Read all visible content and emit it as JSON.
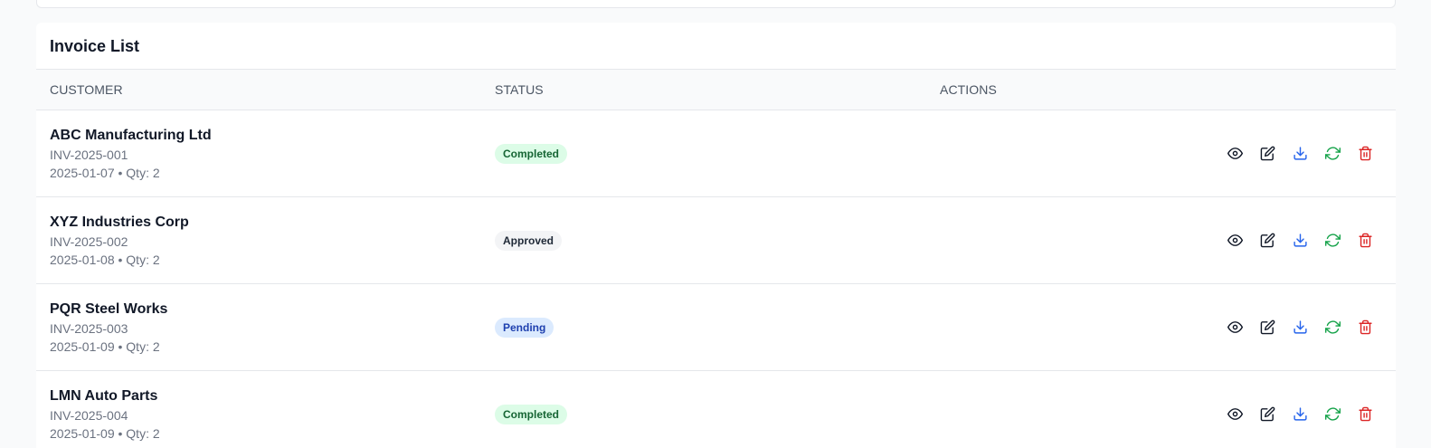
{
  "invoice_list": {
    "title": "Invoice List",
    "columns": {
      "customer": "CUSTOMER",
      "status": "STATUS",
      "actions": "ACTIONS"
    },
    "rows": [
      {
        "customer": "ABC Manufacturing Ltd",
        "invoice_no": "INV-2025-001",
        "meta": "2025-01-07 • Qty: 2",
        "status": "Completed",
        "status_style": "completed"
      },
      {
        "customer": "XYZ Industries Corp",
        "invoice_no": "INV-2025-002",
        "meta": "2025-01-08 • Qty: 2",
        "status": "Approved",
        "status_style": "approved"
      },
      {
        "customer": "PQR Steel Works",
        "invoice_no": "INV-2025-003",
        "meta": "2025-01-09 • Qty: 2",
        "status": "Pending",
        "status_style": "pending"
      },
      {
        "customer": "LMN Auto Parts",
        "invoice_no": "INV-2025-004",
        "meta": "2025-01-09 • Qty: 2",
        "status": "Completed",
        "status_style": "completed"
      }
    ],
    "actions": [
      {
        "name": "view",
        "icon": "eye-icon",
        "color": "#111827"
      },
      {
        "name": "edit",
        "icon": "edit-icon",
        "color": "#111827"
      },
      {
        "name": "download",
        "icon": "download-icon",
        "color": "#2563eb"
      },
      {
        "name": "refresh",
        "icon": "refresh-icon",
        "color": "#16a34a"
      },
      {
        "name": "delete",
        "icon": "trash-icon",
        "color": "#dc2626"
      }
    ]
  },
  "status_colors": {
    "completed": {
      "bg": "#dcfce7",
      "fg": "#166534"
    },
    "approved": {
      "bg": "#f3f4f6",
      "fg": "#1f2937"
    },
    "pending": {
      "bg": "#dbeafe",
      "fg": "#1e40af"
    }
  }
}
